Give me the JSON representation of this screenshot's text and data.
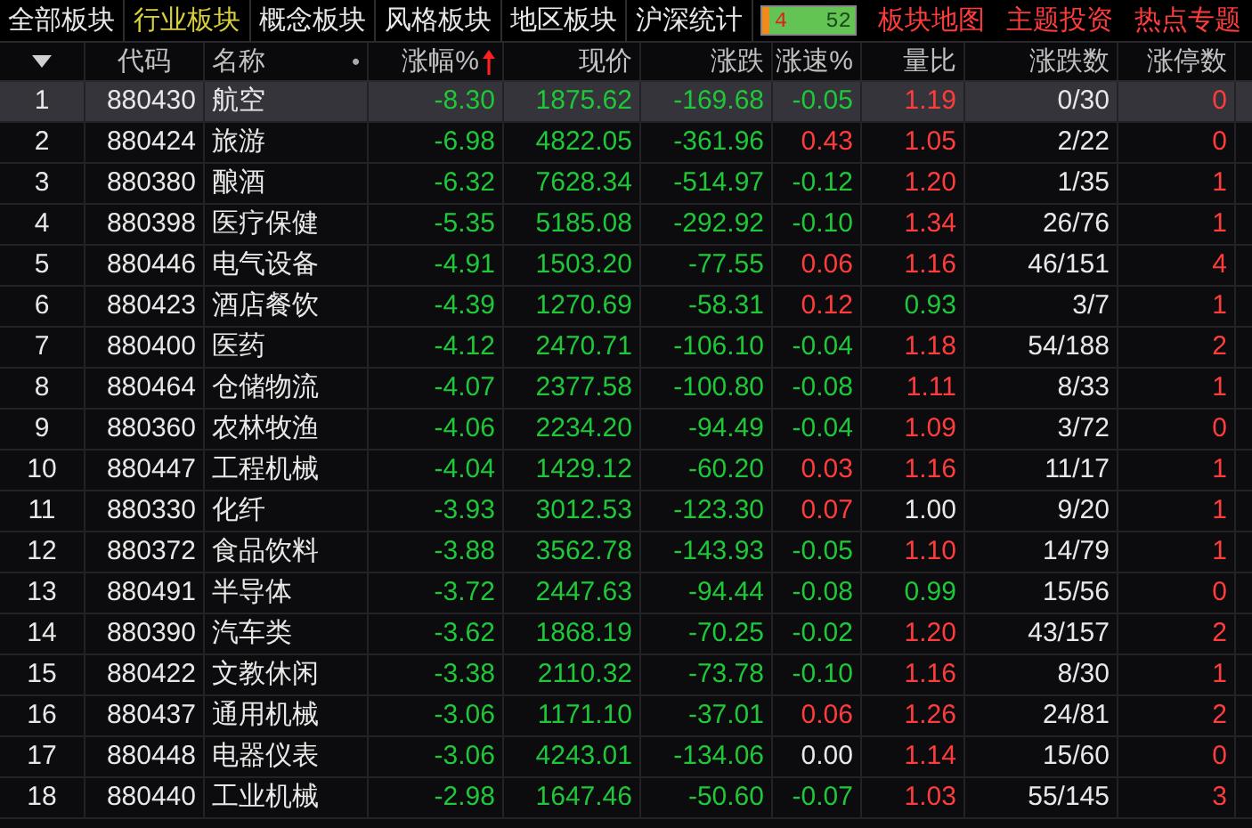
{
  "tabs": [
    {
      "label": "全部板块",
      "selected": false
    },
    {
      "label": "行业板块",
      "selected": true
    },
    {
      "label": "概念板块",
      "selected": false
    },
    {
      "label": "风格板块",
      "selected": false
    },
    {
      "label": "地区板块",
      "selected": false
    },
    {
      "label": "沪深统计",
      "selected": false
    }
  ],
  "breadth": {
    "up_count": "4",
    "down_count": "52",
    "level": 0.07
  },
  "links": [
    "板块地图",
    "主题投资",
    "热点专题"
  ],
  "columns": [
    {
      "label": "代码",
      "sorted": false
    },
    {
      "label": "名称",
      "sorted": false
    },
    {
      "label": "涨幅%",
      "sorted": true
    },
    {
      "label": "现价",
      "sorted": false
    },
    {
      "label": "涨跌",
      "sorted": false
    },
    {
      "label": "涨速%",
      "sorted": false
    },
    {
      "label": "量比",
      "sorted": false
    },
    {
      "label": "涨跌数",
      "sorted": false
    },
    {
      "label": "涨停数",
      "sorted": false
    }
  ],
  "name_marker": "•",
  "rows": [
    {
      "index": "1",
      "code": "880430",
      "name": "航空",
      "change_pct": "-8.30",
      "price": "1875.62",
      "change": "-169.68",
      "speed": {
        "text": "-0.05",
        "color": "#1ec838"
      },
      "ratio": {
        "text": "1.19",
        "color": "#ff3c3c"
      },
      "up_down": "0/30",
      "limit_up": "0",
      "selected": true
    },
    {
      "index": "2",
      "code": "880424",
      "name": "旅游",
      "change_pct": "-6.98",
      "price": "4822.05",
      "change": "-361.96",
      "speed": {
        "text": "0.43",
        "color": "#ff3c3c"
      },
      "ratio": {
        "text": "1.05",
        "color": "#ff3c3c"
      },
      "up_down": "2/22",
      "limit_up": "0",
      "selected": false
    },
    {
      "index": "3",
      "code": "880380",
      "name": "酿酒",
      "change_pct": "-6.32",
      "price": "7628.34",
      "change": "-514.97",
      "speed": {
        "text": "-0.12",
        "color": "#1ec838"
      },
      "ratio": {
        "text": "1.20",
        "color": "#ff3c3c"
      },
      "up_down": "1/35",
      "limit_up": "1",
      "selected": false
    },
    {
      "index": "4",
      "code": "880398",
      "name": "医疗保健",
      "change_pct": "-5.35",
      "price": "5185.08",
      "change": "-292.92",
      "speed": {
        "text": "-0.10",
        "color": "#1ec838"
      },
      "ratio": {
        "text": "1.34",
        "color": "#ff3c3c"
      },
      "up_down": "26/76",
      "limit_up": "1",
      "selected": false
    },
    {
      "index": "5",
      "code": "880446",
      "name": "电气设备",
      "change_pct": "-4.91",
      "price": "1503.20",
      "change": "-77.55",
      "speed": {
        "text": "0.06",
        "color": "#ff3c3c"
      },
      "ratio": {
        "text": "1.16",
        "color": "#ff3c3c"
      },
      "up_down": "46/151",
      "limit_up": "4",
      "selected": false
    },
    {
      "index": "6",
      "code": "880423",
      "name": "酒店餐饮",
      "change_pct": "-4.39",
      "price": "1270.69",
      "change": "-58.31",
      "speed": {
        "text": "0.12",
        "color": "#ff3c3c"
      },
      "ratio": {
        "text": "0.93",
        "color": "#1ec838"
      },
      "up_down": "3/7",
      "limit_up": "1",
      "selected": false
    },
    {
      "index": "7",
      "code": "880400",
      "name": "医药",
      "change_pct": "-4.12",
      "price": "2470.71",
      "change": "-106.10",
      "speed": {
        "text": "-0.04",
        "color": "#1ec838"
      },
      "ratio": {
        "text": "1.18",
        "color": "#ff3c3c"
      },
      "up_down": "54/188",
      "limit_up": "2",
      "selected": false
    },
    {
      "index": "8",
      "code": "880464",
      "name": "仓储物流",
      "change_pct": "-4.07",
      "price": "2377.58",
      "change": "-100.80",
      "speed": {
        "text": "-0.08",
        "color": "#1ec838"
      },
      "ratio": {
        "text": "1.11",
        "color": "#ff3c3c"
      },
      "up_down": "8/33",
      "limit_up": "1",
      "selected": false
    },
    {
      "index": "9",
      "code": "880360",
      "name": "农林牧渔",
      "change_pct": "-4.06",
      "price": "2234.20",
      "change": "-94.49",
      "speed": {
        "text": "-0.04",
        "color": "#1ec838"
      },
      "ratio": {
        "text": "1.09",
        "color": "#ff3c3c"
      },
      "up_down": "3/72",
      "limit_up": "0",
      "selected": false
    },
    {
      "index": "10",
      "code": "880447",
      "name": "工程机械",
      "change_pct": "-4.04",
      "price": "1429.12",
      "change": "-60.20",
      "speed": {
        "text": "0.03",
        "color": "#ff3c3c"
      },
      "ratio": {
        "text": "1.16",
        "color": "#ff3c3c"
      },
      "up_down": "11/17",
      "limit_up": "1",
      "selected": false
    },
    {
      "index": "11",
      "code": "880330",
      "name": "化纤",
      "change_pct": "-3.93",
      "price": "3012.53",
      "change": "-123.30",
      "speed": {
        "text": "0.07",
        "color": "#ff3c3c"
      },
      "ratio": {
        "text": "1.00",
        "color": "#e8e8e8"
      },
      "up_down": "9/20",
      "limit_up": "1",
      "selected": false
    },
    {
      "index": "12",
      "code": "880372",
      "name": "食品饮料",
      "change_pct": "-3.88",
      "price": "3562.78",
      "change": "-143.93",
      "speed": {
        "text": "-0.05",
        "color": "#1ec838"
      },
      "ratio": {
        "text": "1.10",
        "color": "#ff3c3c"
      },
      "up_down": "14/79",
      "limit_up": "1",
      "selected": false
    },
    {
      "index": "13",
      "code": "880491",
      "name": "半导体",
      "change_pct": "-3.72",
      "price": "2447.63",
      "change": "-94.44",
      "speed": {
        "text": "-0.08",
        "color": "#1ec838"
      },
      "ratio": {
        "text": "0.99",
        "color": "#1ec838"
      },
      "up_down": "15/56",
      "limit_up": "0",
      "selected": false
    },
    {
      "index": "14",
      "code": "880390",
      "name": "汽车类",
      "change_pct": "-3.62",
      "price": "1868.19",
      "change": "-70.25",
      "speed": {
        "text": "-0.02",
        "color": "#1ec838"
      },
      "ratio": {
        "text": "1.20",
        "color": "#ff3c3c"
      },
      "up_down": "43/157",
      "limit_up": "2",
      "selected": false
    },
    {
      "index": "15",
      "code": "880422",
      "name": "文教休闲",
      "change_pct": "-3.38",
      "price": "2110.32",
      "change": "-73.78",
      "speed": {
        "text": "-0.10",
        "color": "#1ec838"
      },
      "ratio": {
        "text": "1.16",
        "color": "#ff3c3c"
      },
      "up_down": "8/30",
      "limit_up": "1",
      "selected": false
    },
    {
      "index": "16",
      "code": "880437",
      "name": "通用机械",
      "change_pct": "-3.06",
      "price": "1171.10",
      "change": "-37.01",
      "speed": {
        "text": "0.06",
        "color": "#ff3c3c"
      },
      "ratio": {
        "text": "1.26",
        "color": "#ff3c3c"
      },
      "up_down": "24/81",
      "limit_up": "2",
      "selected": false
    },
    {
      "index": "17",
      "code": "880448",
      "name": "电器仪表",
      "change_pct": "-3.06",
      "price": "4243.01",
      "change": "-134.06",
      "speed": {
        "text": "0.00",
        "color": "#e8e8e8"
      },
      "ratio": {
        "text": "1.14",
        "color": "#ff3c3c"
      },
      "up_down": "15/60",
      "limit_up": "0",
      "selected": false
    },
    {
      "index": "18",
      "code": "880440",
      "name": "工业机械",
      "change_pct": "-2.98",
      "price": "1647.46",
      "change": "-50.60",
      "speed": {
        "text": "-0.07",
        "color": "#1ec838"
      },
      "ratio": {
        "text": "1.03",
        "color": "#ff3c3c"
      },
      "up_down": "55/145",
      "limit_up": "3",
      "selected": false
    }
  ]
}
